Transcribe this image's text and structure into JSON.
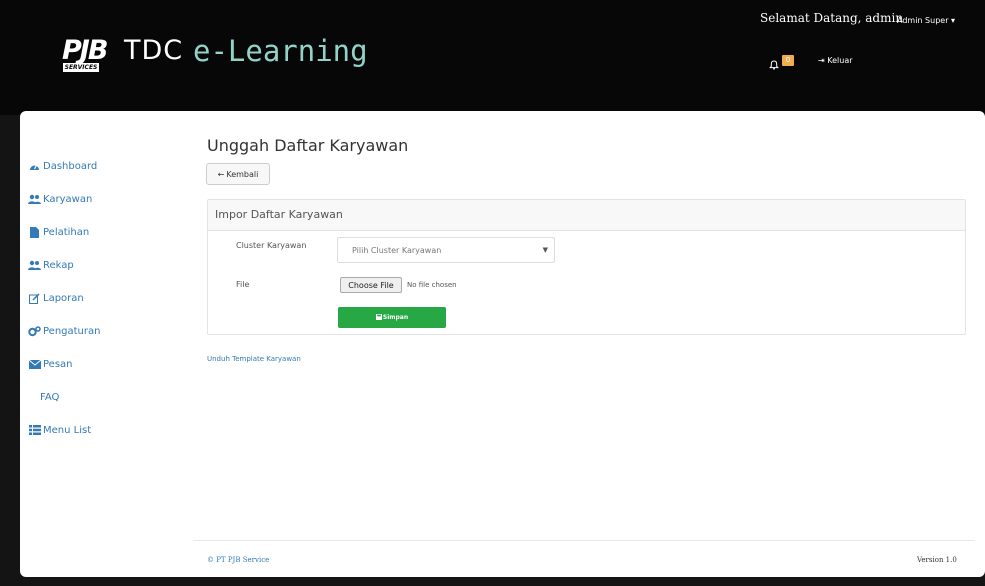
{
  "header": {
    "logo_pjb": "PJB",
    "logo_services": "SERVICES",
    "logo_tdc": "TDC",
    "logo_elearning": "e-Learning",
    "welcome": "Selamat Datang, admin",
    "user_menu": "Admin Super ▾",
    "notif_count": "0",
    "logout_label": "Keluar"
  },
  "sidebar": {
    "items": [
      {
        "label": "Dashboard",
        "icon": "dashboard-icon"
      },
      {
        "label": "Karyawan",
        "icon": "users-icon"
      },
      {
        "label": "Pelatihan",
        "icon": "file-icon"
      },
      {
        "label": "Rekap",
        "icon": "users-icon"
      },
      {
        "label": "Laporan",
        "icon": "edit-icon"
      },
      {
        "label": "Pengaturan",
        "icon": "gears-icon"
      },
      {
        "label": "Pesan",
        "icon": "envelope-icon"
      },
      {
        "label": "FAQ",
        "icon": ""
      },
      {
        "label": "Menu List",
        "icon": "list-icon"
      }
    ]
  },
  "main": {
    "title": "Unggah Daftar Karyawan",
    "back_label": "Kembali",
    "panel_title": "Impor Daftar Karyawan",
    "cluster_label": "Cluster Karyawan",
    "cluster_select": "Pilih Cluster Karyawan",
    "file_label": "File",
    "choose_file": "Choose File",
    "no_file": "No file chosen",
    "save_label": "Simpan",
    "template_link": "Unduh Template Karyawan"
  },
  "footer": {
    "copyright": "© PT PJB Service",
    "version": "Version 1.0"
  },
  "colors": {
    "header_bg": "#070707",
    "accent_link": "#337ab7",
    "logo_teal": "#93d3c7",
    "save_green": "#28a745",
    "badge_orange": "#f0ad4e"
  }
}
